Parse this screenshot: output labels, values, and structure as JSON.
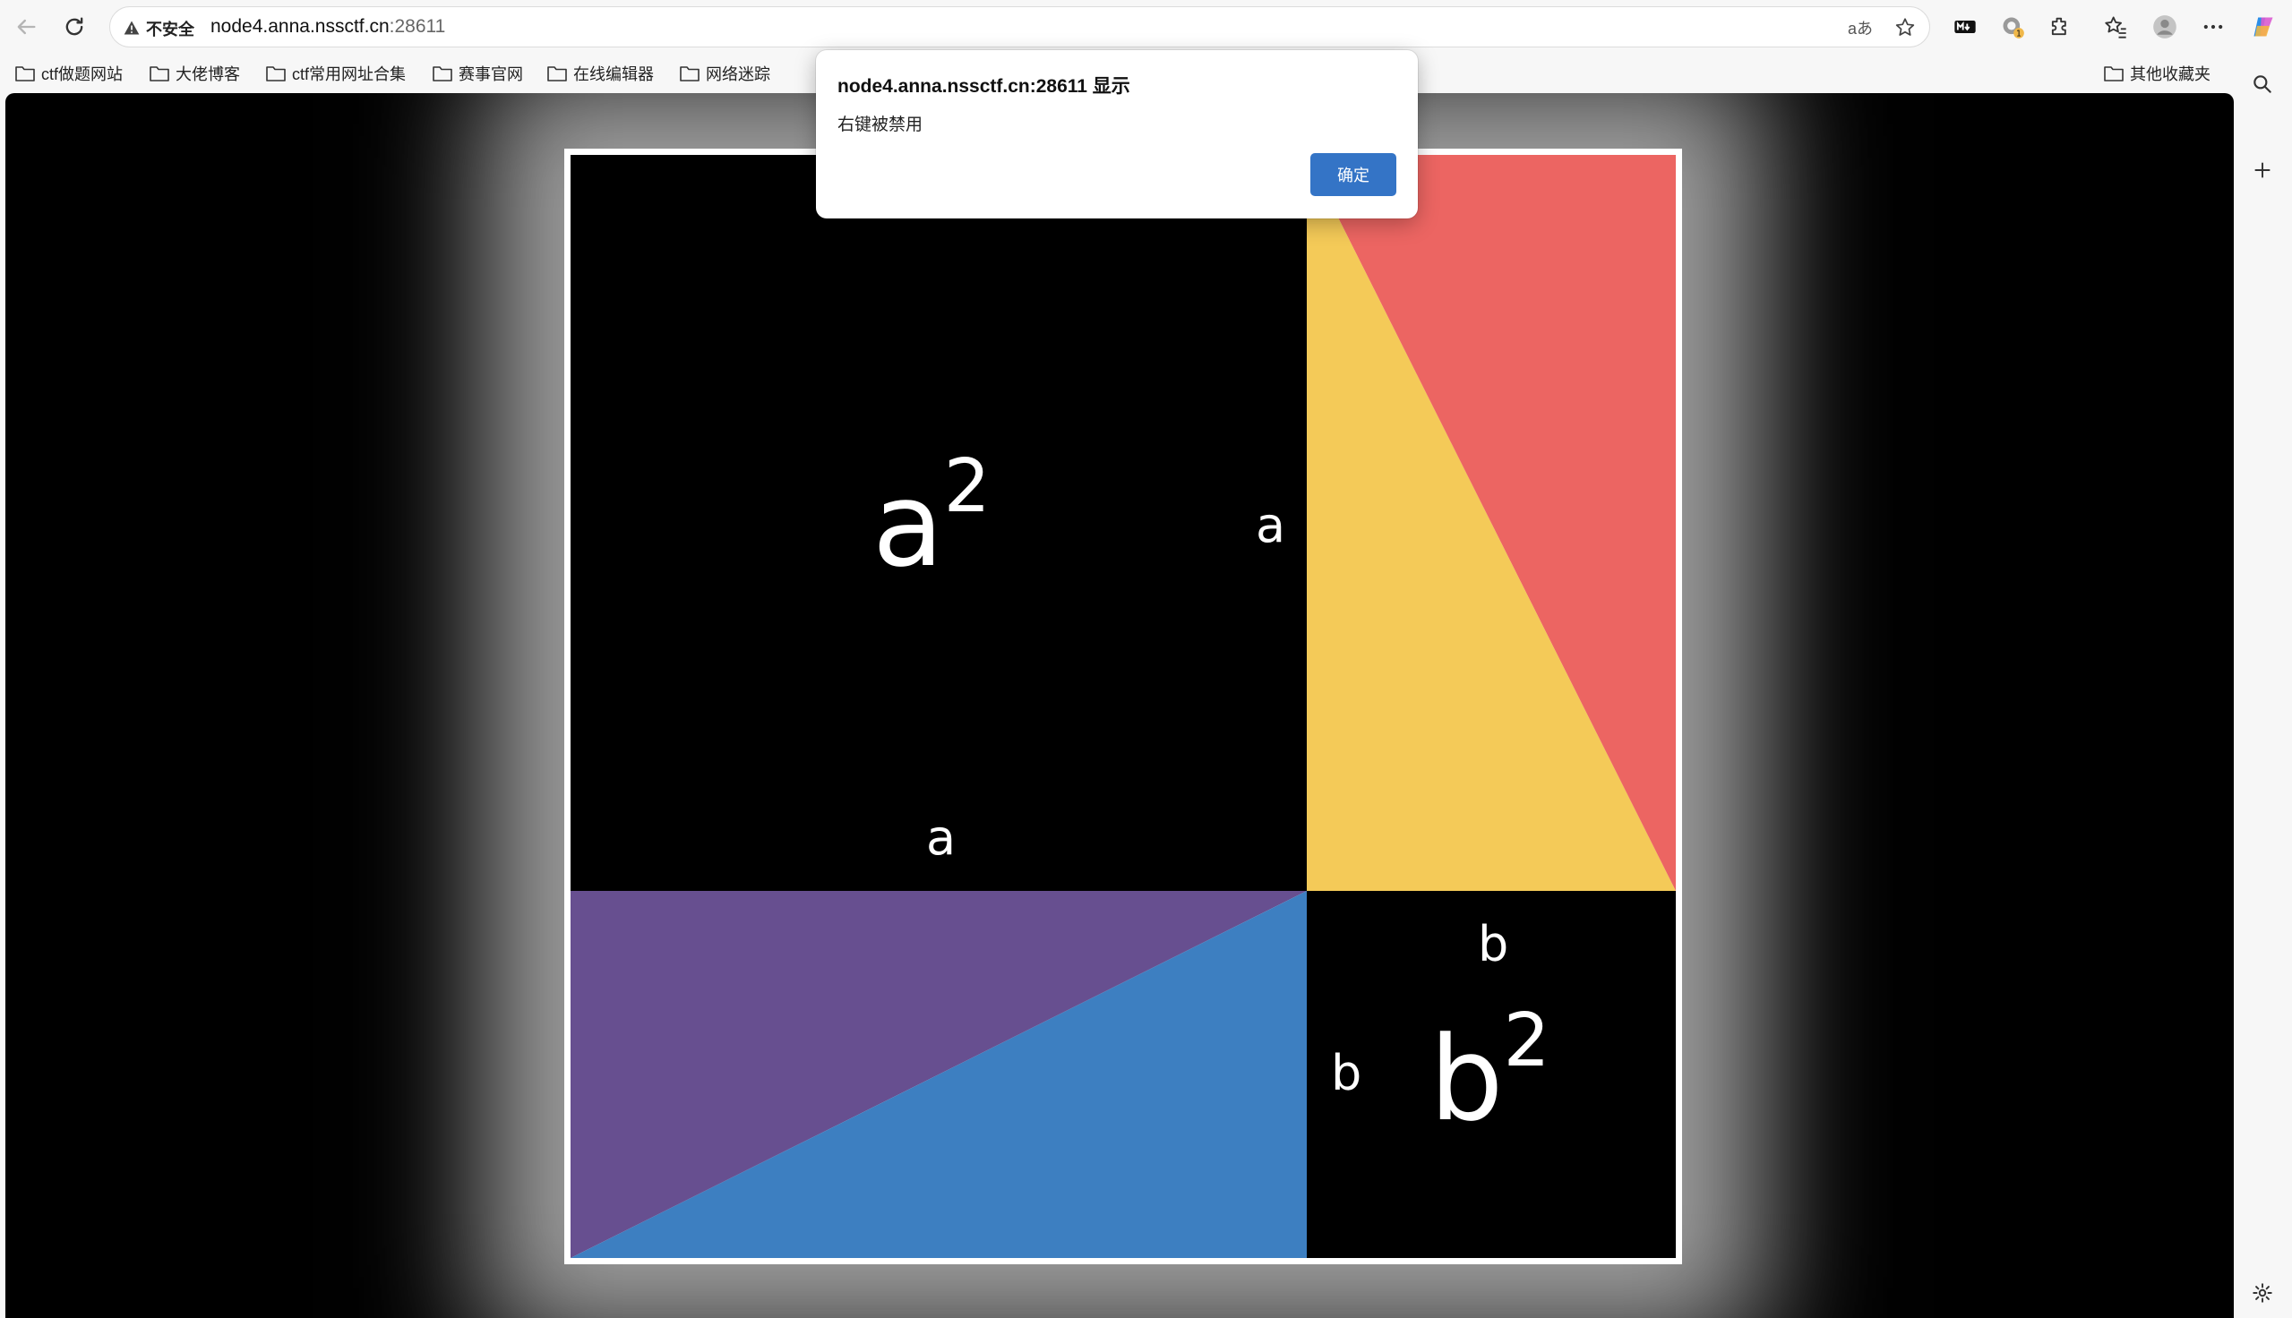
{
  "browser": {
    "not_secure_label": "不安全",
    "url_host": "node4.anna.nssctf.cn",
    "url_port": ":28611",
    "translate_glyph": "aあ"
  },
  "bookmarks": [
    {
      "label": "ctf做题网站"
    },
    {
      "label": "大佬博客"
    },
    {
      "label": "ctf常用网址合集"
    },
    {
      "label": "赛事官网"
    },
    {
      "label": "在线编辑器"
    },
    {
      "label": "网络迷踪"
    }
  ],
  "other_bookmarks": "其他收藏夹",
  "page": {
    "a_square": {
      "base": "a",
      "exp": "2"
    },
    "b_square": {
      "base": "b",
      "exp": "2"
    },
    "side_a_right": "a",
    "side_a_bottom": "a",
    "side_b_top": "b",
    "side_b_left": "b",
    "colors": {
      "yellow": "#F4CA58",
      "red": "#EC6562",
      "purple": "#674F90",
      "blue": "#3D7FC1"
    }
  },
  "dialog": {
    "title": "node4.anna.nssctf.cn:28611 显示",
    "message": "右键被禁用",
    "ok_label": "确定"
  }
}
